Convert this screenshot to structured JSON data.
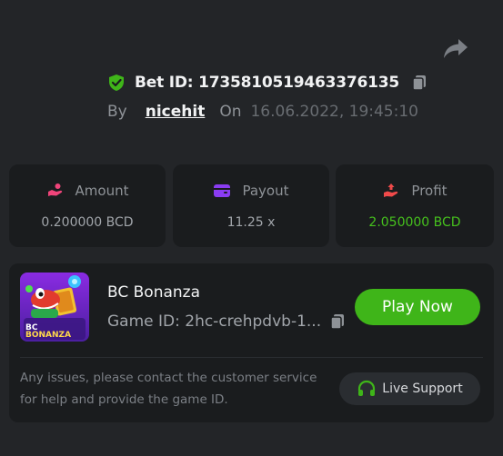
{
  "header": {
    "bet_id_text": "Bet ID: 1735810519463376135",
    "by_label": "By",
    "username": "nicehit",
    "on_label": "On",
    "datetime": "16.06.2022, 19:45:10"
  },
  "stats": [
    {
      "title": "Amount",
      "value": "0.200000 BCD",
      "icon": "hand-coins-icon",
      "color": "#f0447a"
    },
    {
      "title": "Payout",
      "value": "11.25 x",
      "icon": "wallet-icon",
      "color": "#8a3cf2"
    },
    {
      "title": "Profit",
      "value": "2.050000 BCD",
      "icon": "profit-hand-icon",
      "color": "#f04a4a",
      "value_color": "#46c11d"
    }
  ],
  "game": {
    "name": "BC Bonanza",
    "id_text": "Game ID: 2hc-crehpdvb-1...",
    "thumb_text_line1": "BC",
    "thumb_text_line2": "BONANZA",
    "play_label": "Play Now",
    "issue_text": "Any issues, please contact the customer service for help and provide the game ID.",
    "support_label": "Live Support"
  },
  "colors": {
    "accent_green": "#3fb519",
    "background": "#232528",
    "card": "#1a1c1e"
  }
}
